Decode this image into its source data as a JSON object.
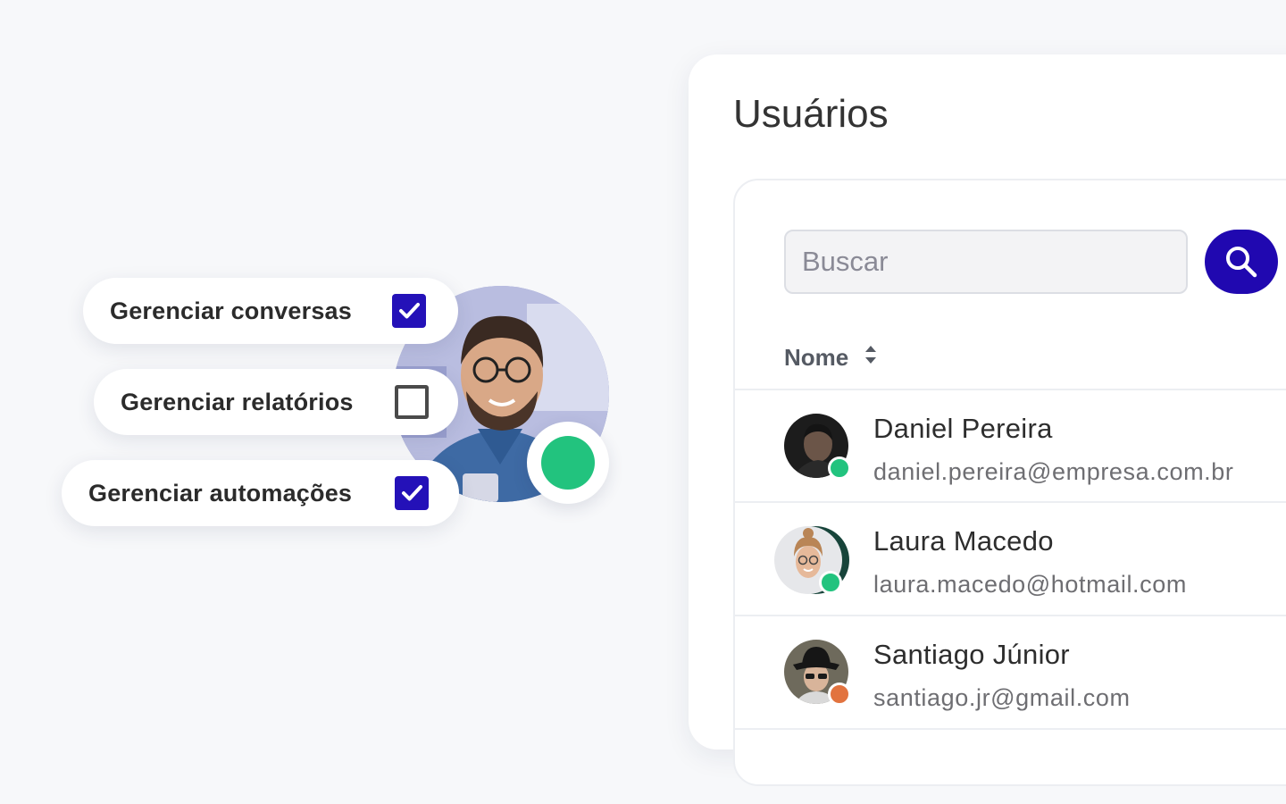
{
  "colors": {
    "accent": "#2008b0",
    "checkbox_checked": "#2411b8",
    "online": "#22c37e",
    "away": "#e2733f"
  },
  "permissions": [
    {
      "label": "Gerenciar conversas",
      "checked": true
    },
    {
      "label": "Gerenciar relatórios",
      "checked": false
    },
    {
      "label": "Gerenciar automações",
      "checked": true
    }
  ],
  "hero_user": {
    "status": "online"
  },
  "users_panel": {
    "title": "Usuários",
    "search": {
      "placeholder": "Buscar",
      "value": "",
      "button_icon": "search-icon"
    },
    "table": {
      "column_header": "Nome",
      "sort_icon": "sort-icon",
      "rows": [
        {
          "name": "Daniel Pereira",
          "email": "daniel.pereira@empresa.com.br",
          "status": "online"
        },
        {
          "name": "Laura Macedo",
          "email": "laura.macedo@hotmail.com",
          "status": "online"
        },
        {
          "name": "Santiago Júnior",
          "email": "santiago.jr@gmail.com",
          "status": "away"
        }
      ]
    }
  }
}
